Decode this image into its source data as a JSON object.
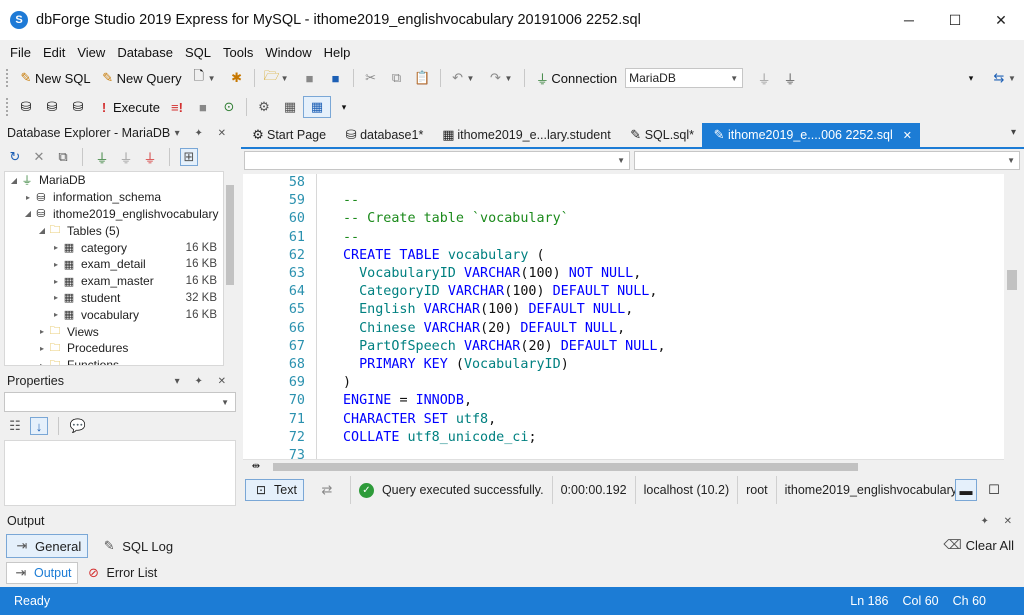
{
  "window": {
    "title": "dbForge Studio 2019 Express for MySQL - ithome2019_englishvocabulary 20191006 2252.sql",
    "logo_text": "S",
    "controls": {
      "minimize": "─",
      "maximize": "☐",
      "close": "✕"
    }
  },
  "menu": [
    "File",
    "Edit",
    "View",
    "Database",
    "SQL",
    "Tools",
    "Window",
    "Help"
  ],
  "toolbar1": {
    "new_sql": "New SQL",
    "new_query": "New Query",
    "connection_label": "Connection",
    "connection_value": "MariaDB"
  },
  "toolbar2": {
    "execute": "Execute"
  },
  "explorer": {
    "title": "Database Explorer - MariaDB",
    "header_icons": "▾ ✦ ✕",
    "tree": [
      {
        "label": "MariaDB",
        "size": "",
        "level": 0,
        "tri": "◢",
        "icon": "plug-icon"
      },
      {
        "label": "information_schema",
        "size": "",
        "level": 1,
        "tri": "▸",
        "icon": "database-icon"
      },
      {
        "label": "ithome2019_englishvocabulary",
        "size": "",
        "level": 1,
        "tri": "◢",
        "icon": "database-icon"
      },
      {
        "label": "Tables (5)",
        "size": "",
        "level": 2,
        "tri": "◢",
        "icon": "folder-icon"
      },
      {
        "label": "category",
        "size": "16 KB",
        "level": 3,
        "tri": "▸",
        "icon": "table-icon"
      },
      {
        "label": "exam_detail",
        "size": "16 KB",
        "level": 3,
        "tri": "▸",
        "icon": "table-icon"
      },
      {
        "label": "exam_master",
        "size": "16 KB",
        "level": 3,
        "tri": "▸",
        "icon": "table-icon"
      },
      {
        "label": "student",
        "size": "32 KB",
        "level": 3,
        "tri": "▸",
        "icon": "table-icon"
      },
      {
        "label": "vocabulary",
        "size": "16 KB",
        "level": 3,
        "tri": "▸",
        "icon": "table-icon"
      },
      {
        "label": "Views",
        "size": "",
        "level": 2,
        "tri": "▸",
        "icon": "folder-icon"
      },
      {
        "label": "Procedures",
        "size": "",
        "level": 2,
        "tri": "▸",
        "icon": "folder-icon"
      },
      {
        "label": "Functions",
        "size": "",
        "level": 2,
        "tri": "▸",
        "icon": "folder-icon"
      }
    ]
  },
  "properties": {
    "title": "Properties",
    "header_icons": "▾ ✦ ✕"
  },
  "tabs": [
    {
      "label": "Start Page",
      "icon": "⚙",
      "active": false
    },
    {
      "label": "database1*",
      "icon": "⛁",
      "active": false
    },
    {
      "label": "ithome2019_e...lary.student",
      "icon": "▦",
      "active": false
    },
    {
      "label": "SQL.sql*",
      "icon": "✎",
      "active": false
    },
    {
      "label": "ithome2019_e....006 2252.sql",
      "icon": "✎",
      "active": true,
      "close": "✕"
    }
  ],
  "editor": {
    "lines": [
      {
        "n": "58",
        "parts": []
      },
      {
        "n": "59",
        "parts": [
          {
            "t": "--",
            "c": "c-cmt"
          }
        ]
      },
      {
        "n": "60",
        "parts": [
          {
            "t": "-- Create table `vocabulary`",
            "c": "c-cmt"
          }
        ]
      },
      {
        "n": "61",
        "parts": [
          {
            "t": "--",
            "c": "c-cmt"
          }
        ]
      },
      {
        "n": "62",
        "parts": [
          {
            "t": "CREATE TABLE ",
            "c": "c-kw"
          },
          {
            "t": "vocabulary",
            "c": "c-id"
          },
          {
            "t": " (",
            "c": "c-op"
          }
        ]
      },
      {
        "n": "63",
        "parts": [
          {
            "t": "  VocabularyID ",
            "c": "c-id"
          },
          {
            "t": "VARCHAR",
            "c": "c-kw"
          },
          {
            "t": "(",
            "c": "c-op"
          },
          {
            "t": "100",
            "c": "c-num"
          },
          {
            "t": ") ",
            "c": "c-op"
          },
          {
            "t": "NOT NULL",
            "c": "c-kw"
          },
          {
            "t": ",",
            "c": "c-op"
          }
        ]
      },
      {
        "n": "64",
        "parts": [
          {
            "t": "  CategoryID ",
            "c": "c-id"
          },
          {
            "t": "VARCHAR",
            "c": "c-kw"
          },
          {
            "t": "(",
            "c": "c-op"
          },
          {
            "t": "100",
            "c": "c-num"
          },
          {
            "t": ") ",
            "c": "c-op"
          },
          {
            "t": "DEFAULT NULL",
            "c": "c-kw"
          },
          {
            "t": ",",
            "c": "c-op"
          }
        ]
      },
      {
        "n": "65",
        "parts": [
          {
            "t": "  English ",
            "c": "c-id"
          },
          {
            "t": "VARCHAR",
            "c": "c-kw"
          },
          {
            "t": "(",
            "c": "c-op"
          },
          {
            "t": "100",
            "c": "c-num"
          },
          {
            "t": ") ",
            "c": "c-op"
          },
          {
            "t": "DEFAULT NULL",
            "c": "c-kw"
          },
          {
            "t": ",",
            "c": "c-op"
          }
        ]
      },
      {
        "n": "66",
        "parts": [
          {
            "t": "  Chinese ",
            "c": "c-id"
          },
          {
            "t": "VARCHAR",
            "c": "c-kw"
          },
          {
            "t": "(",
            "c": "c-op"
          },
          {
            "t": "20",
            "c": "c-num"
          },
          {
            "t": ") ",
            "c": "c-op"
          },
          {
            "t": "DEFAULT NULL",
            "c": "c-kw"
          },
          {
            "t": ",",
            "c": "c-op"
          }
        ]
      },
      {
        "n": "67",
        "parts": [
          {
            "t": "  PartOfSpeech ",
            "c": "c-id"
          },
          {
            "t": "VARCHAR",
            "c": "c-kw"
          },
          {
            "t": "(",
            "c": "c-op"
          },
          {
            "t": "20",
            "c": "c-num"
          },
          {
            "t": ") ",
            "c": "c-op"
          },
          {
            "t": "DEFAULT NULL",
            "c": "c-kw"
          },
          {
            "t": ",",
            "c": "c-op"
          }
        ]
      },
      {
        "n": "68",
        "parts": [
          {
            "t": "  PRIMARY KEY ",
            "c": "c-kw"
          },
          {
            "t": "(",
            "c": "c-op"
          },
          {
            "t": "VocabularyID",
            "c": "c-id"
          },
          {
            "t": ")",
            "c": "c-op"
          }
        ]
      },
      {
        "n": "69",
        "parts": [
          {
            "t": ")",
            "c": "c-op"
          }
        ]
      },
      {
        "n": "70",
        "parts": [
          {
            "t": "ENGINE ",
            "c": "c-kw"
          },
          {
            "t": "= ",
            "c": "c-op"
          },
          {
            "t": "INNODB",
            "c": "c-kw"
          },
          {
            "t": ",",
            "c": "c-op"
          }
        ]
      },
      {
        "n": "71",
        "parts": [
          {
            "t": "CHARACTER SET ",
            "c": "c-kw"
          },
          {
            "t": "utf8",
            "c": "c-id"
          },
          {
            "t": ",",
            "c": "c-op"
          }
        ]
      },
      {
        "n": "72",
        "parts": [
          {
            "t": "COLLATE ",
            "c": "c-kw"
          },
          {
            "t": "utf8_unicode_ci",
            "c": "c-id"
          },
          {
            "t": ";",
            "c": "c-op"
          }
        ]
      },
      {
        "n": "73",
        "parts": []
      }
    ]
  },
  "status_strip": {
    "text_button": "Text",
    "message": "Query executed successfully.",
    "duration": "0:00:00.192",
    "host": "localhost (10.2)",
    "user": "root",
    "database": "ithome2019_englishvocabulary"
  },
  "output": {
    "title": "Output",
    "header_icons": "✦ ✕",
    "general": "General",
    "sql_log": "SQL Log",
    "clear_all": "Clear All",
    "tab_output": "Output",
    "tab_errors": "Error List"
  },
  "statusbar": {
    "ready": "Ready",
    "ln": "Ln 186",
    "col": "Col 60",
    "ch": "Ch 60"
  },
  "colors": {
    "accent": "#1c7cd5",
    "keyword": "#0000ff",
    "identifier": "#008080",
    "comment": "#1b8a1b",
    "line_number": "#2b91af",
    "success": "#2e9b3a"
  }
}
